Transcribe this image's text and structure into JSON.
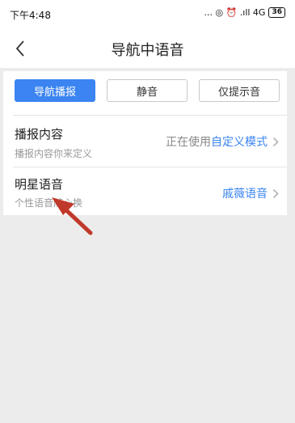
{
  "status": {
    "time": "下午4:48",
    "indicators": "... ◎ ⏰ .ıll 4G",
    "battery": "36"
  },
  "nav": {
    "title": "导航中语音"
  },
  "modes": [
    {
      "label": "导航播报",
      "active": true
    },
    {
      "label": "静音",
      "active": false
    },
    {
      "label": "仅提示音",
      "active": false
    }
  ],
  "broadcast": {
    "title": "播报内容",
    "subtitle": "播报内容你来定义",
    "status_prefix": "正在使用",
    "status_link": "自定义模式"
  },
  "star_voice": {
    "title": "明星语音",
    "subtitle": "个性语音随心换",
    "value": "戚薇语音"
  },
  "colors": {
    "accent": "#3b84f1",
    "annotation_arrow": "#c0392b"
  }
}
